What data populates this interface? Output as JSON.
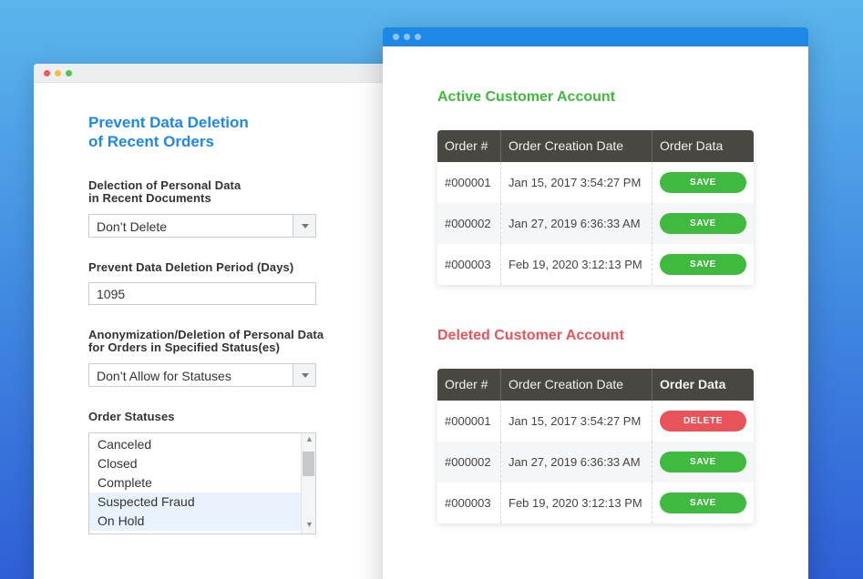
{
  "left_window": {
    "title": "Prevent Data Deletion of Recent Orders",
    "title_line1": "Prevent Data Deletion",
    "title_line2": "of Recent Orders",
    "field1": {
      "label_line1": "Delection of Personal Data",
      "label_line2": "in Recent Documents",
      "value": "Don’t Delete"
    },
    "field2": {
      "label": "Prevent Data Deletion Period (Days)",
      "value": "1095"
    },
    "field3": {
      "label_line1": "Anonymization/Deletion of Personal Data",
      "label_line2": "for Orders in Specified Status(es)",
      "value": "Don’t Allow for Statuses"
    },
    "field4": {
      "label": "Order Statuses",
      "options": [
        "Canceled",
        "Closed",
        "Complete",
        "Suspected Fraud",
        "On Hold"
      ],
      "selected": [
        "Suspected Fraud",
        "On Hold"
      ]
    }
  },
  "right_window": {
    "active_section": {
      "title": "Active Customer Account",
      "headers": [
        "Order #",
        "Order Creation Date",
        "Order Data"
      ],
      "rows": [
        {
          "order": "#000001",
          "date": "Jan 15, 2017 3:54:27 PM",
          "action": "SAVE"
        },
        {
          "order": "#000002",
          "date": "Jan 27, 2019 6:36:33 AM",
          "action": "SAVE"
        },
        {
          "order": "#000003",
          "date": "Feb 19, 2020 3:12:13 PM",
          "action": "SAVE"
        }
      ]
    },
    "deleted_section": {
      "title": "Deleted Customer Account",
      "headers": [
        "Order #",
        "Order Creation Date",
        "Order Data"
      ],
      "rows": [
        {
          "order": "#000001",
          "date": "Jan 15, 2017 3:54:27 PM",
          "action": "DELETE"
        },
        {
          "order": "#000002",
          "date": "Jan 27, 2019 6:36:33 AM",
          "action": "SAVE"
        },
        {
          "order": "#000003",
          "date": "Feb 19, 2020 3:12:13 PM",
          "action": "SAVE"
        }
      ]
    }
  },
  "colors": {
    "accent_blue": "#1e88e5",
    "save_green": "#3fba3f",
    "delete_red": "#e9545b",
    "table_header": "#4a4641"
  }
}
